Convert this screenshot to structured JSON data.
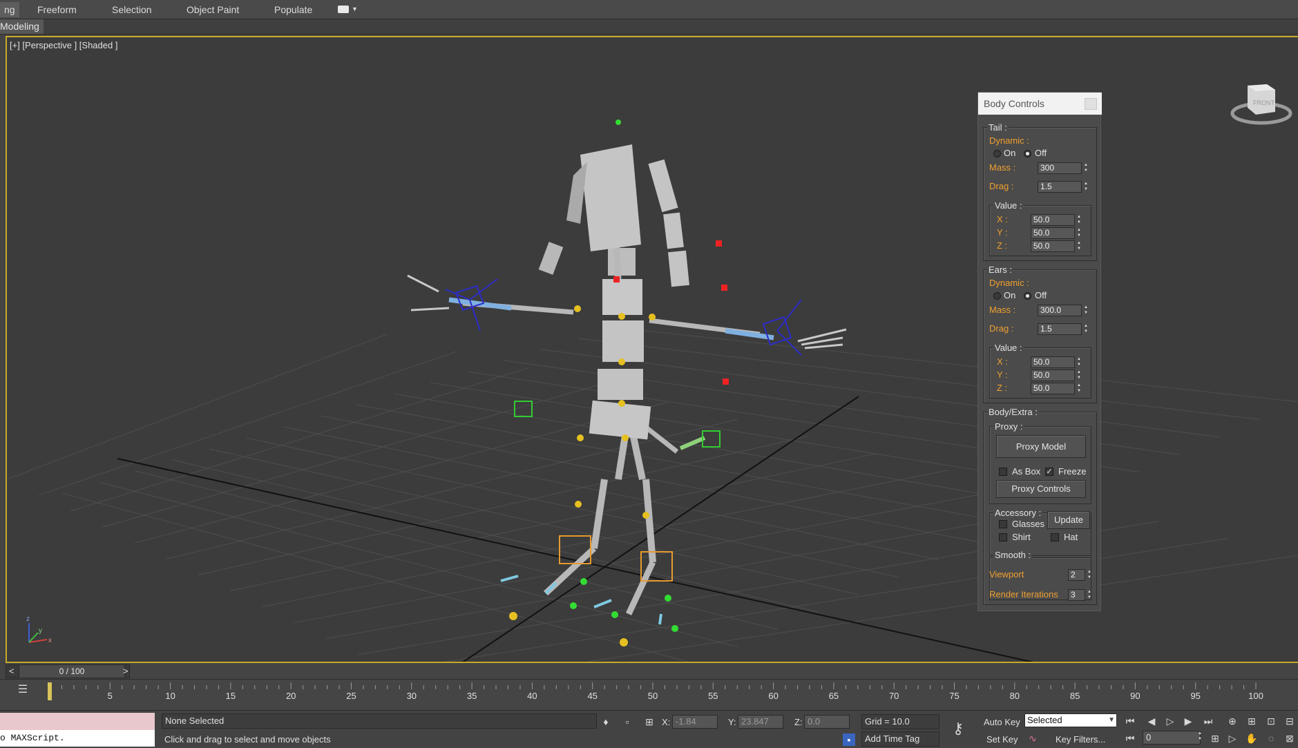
{
  "ribbon": {
    "active_tab_fragment": "ng",
    "tabs": [
      "Freeform",
      "Selection",
      "Object Paint",
      "Populate"
    ],
    "extra_dropdown_icon": "ribbon-options-icon"
  },
  "subbar": {
    "label": "Modeling"
  },
  "viewport": {
    "label": "[+] [Perspective ] [Shaded ]",
    "axis_labels": {
      "x": "x",
      "y": "y",
      "z": "z"
    },
    "viewcube_face": "FRONT",
    "border_color": "#c8aa2a"
  },
  "body_controls": {
    "title": "Body Controls",
    "tail": {
      "group": "Tail :",
      "dynamic_label": "Dynamic :",
      "on_label": "On",
      "off_label": "Off",
      "selected": "Off",
      "mass_label": "Mass :",
      "mass": "300",
      "drag_label": "Drag :",
      "drag": "1.5",
      "value_group": "Value :",
      "x_label": "X :",
      "x": "50.0",
      "y_label": "Y :",
      "y": "50.0",
      "z_label": "Z :",
      "z": "50.0"
    },
    "ears": {
      "group": "Ears :",
      "dynamic_label": "Dynamic :",
      "on_label": "On",
      "off_label": "Off",
      "selected": "Off",
      "mass_label": "Mass :",
      "mass": "300.0",
      "drag_label": "Drag :",
      "drag": "1.5",
      "value_group": "Value :",
      "x_label": "X :",
      "x": "50.0",
      "y_label": "Y :",
      "y": "50.0",
      "z_label": "Z :",
      "z": "50.0"
    },
    "body_extra": {
      "group": "Body/Extra :",
      "proxy_group": "Proxy :",
      "proxy_model_button": "Proxy Model",
      "as_box_label": "As Box",
      "as_box_checked": false,
      "freeze_label": "Freeze",
      "freeze_checked": true,
      "proxy_controls_button": "Proxy Controls",
      "accessory_group": "Accessory :",
      "glasses_label": "Glasses",
      "shirt_label": "Shirt",
      "hat_label": "Hat",
      "update_button": "Update",
      "smooth_group": "Smooth :",
      "viewport_label": "Viewport",
      "viewport_value": "2",
      "render_label": "Render Iterations",
      "render_value": "3"
    }
  },
  "timeline": {
    "slider_text": "0 / 100",
    "prev_arrow": "<",
    "next_arrow": ">",
    "current_frame": 0,
    "frame_count": 100,
    "tick_labels": [
      "5",
      "10",
      "15",
      "20",
      "25",
      "30",
      "35",
      "40",
      "45",
      "50",
      "55",
      "60",
      "65",
      "70",
      "75",
      "80",
      "85",
      "90",
      "95",
      "100"
    ]
  },
  "status": {
    "maxscript_text": "o MAXScript.",
    "selection": "None Selected",
    "prompt": "Click and drag to select and move objects",
    "x_label": "X:",
    "x": "-1.84",
    "y_label": "Y:",
    "y": "23.847",
    "z_label": "Z:",
    "z": "0.0",
    "grid": "Grid = 10.0",
    "add_time_tag": "Add Time Tag",
    "auto_key": "Auto Key",
    "set_key": "Set Key",
    "key_mode": "Selected",
    "key_filters": "Key Filters...",
    "frame_value": "0"
  }
}
